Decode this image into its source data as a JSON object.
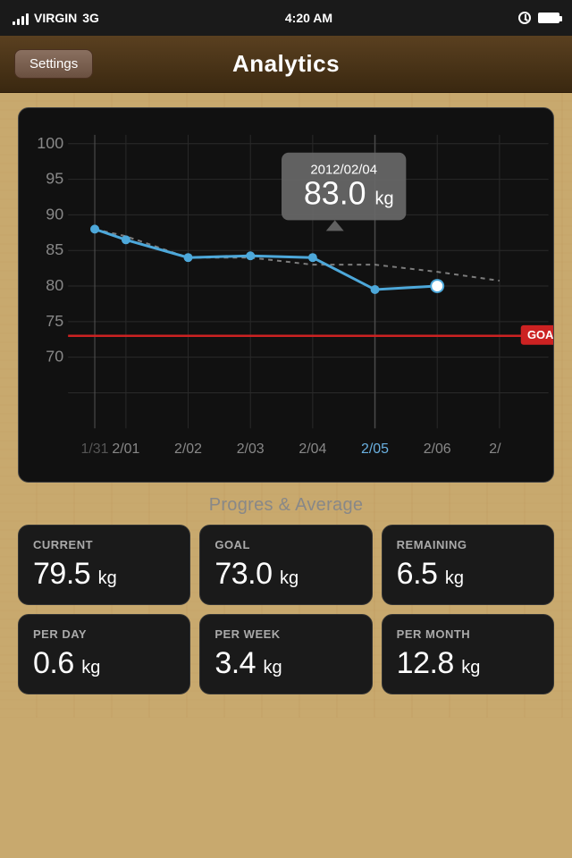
{
  "statusBar": {
    "carrier": "VIRGIN",
    "network": "3G",
    "time": "4:20 AM"
  },
  "nav": {
    "title": "Analytics",
    "settingsLabel": "Settings"
  },
  "chart": {
    "yLabels": [
      "100",
      "95",
      "90",
      "85",
      "80",
      "75",
      "70"
    ],
    "xLabels": [
      "1/31",
      "2/01",
      "2/02",
      "2/03",
      "2/04",
      "2/05",
      "2/06",
      "2/"
    ],
    "tooltip": {
      "date": "2012/02/04",
      "value": "83.0",
      "unit": "kg"
    },
    "goalLabel": "GOAL",
    "goalValue": 73
  },
  "progressSection": {
    "title": "Progres & Average"
  },
  "stats": {
    "row1": [
      {
        "label": "CURRENT",
        "value": "79.5",
        "unit": "kg"
      },
      {
        "label": "GOAL",
        "value": "73.0",
        "unit": "kg"
      },
      {
        "label": "REMAINING",
        "value": "6.5",
        "unit": "kg"
      }
    ],
    "row2": [
      {
        "label": "PER DAY",
        "value": "0.6",
        "unit": "kg"
      },
      {
        "label": "PER WEEK",
        "value": "3.4",
        "unit": "kg"
      },
      {
        "label": "PER MONTH",
        "value": "12.8",
        "unit": "kg"
      }
    ]
  }
}
